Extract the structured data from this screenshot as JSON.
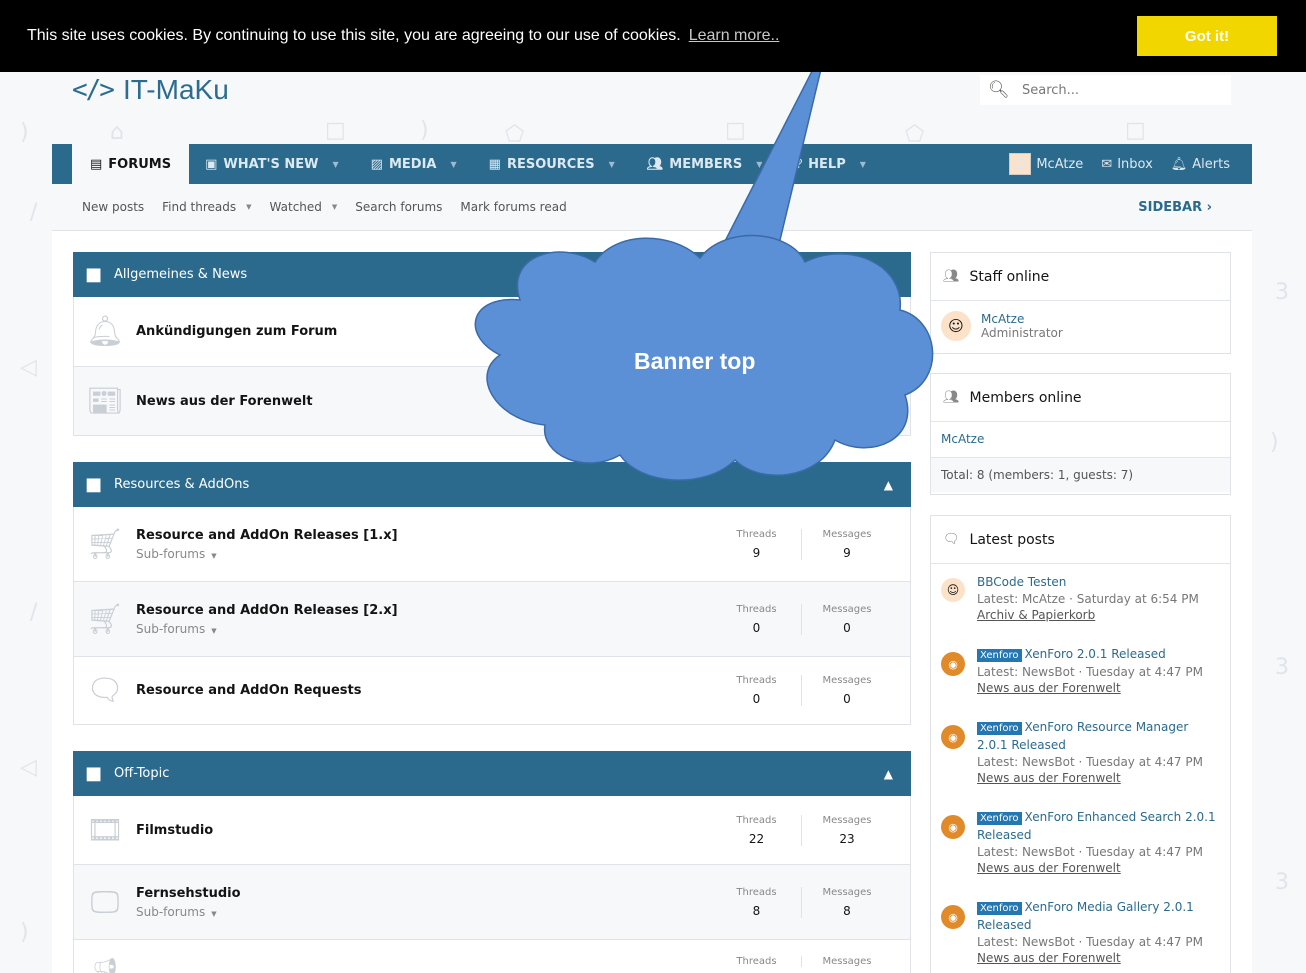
{
  "cookie": {
    "message": "This site uses cookies. By continuing to use this site, you are agreeing to our use of cookies.",
    "learn_more": "Learn more..",
    "got_it": "Got it!"
  },
  "header": {
    "logo_code": "</>",
    "logo_text": "IT-MaKu",
    "search_placeholder": "Search..."
  },
  "nav": {
    "tabs": [
      {
        "label": "Forums",
        "icon": "forum-icon"
      },
      {
        "label": "What's new",
        "icon": "whats-new-icon"
      },
      {
        "label": "Media",
        "icon": "media-icon"
      },
      {
        "label": "Resources",
        "icon": "resources-icon"
      },
      {
        "label": "Members",
        "icon": "members-icon"
      },
      {
        "label": "Help",
        "icon": "help-icon"
      }
    ],
    "user": "McAtze",
    "inbox": "Inbox",
    "alerts": "Alerts"
  },
  "subnav": {
    "new_posts": "New posts",
    "find_threads": "Find threads",
    "watched": "Watched",
    "search_forums": "Search forums",
    "mark_read": "Mark forums read",
    "sidebar": "SIDEBAR"
  },
  "categories": [
    {
      "title": "Allgemeines & News",
      "nodes": [
        {
          "title": "Ankündigungen zum Forum"
        },
        {
          "title": "News aus der Forenwelt"
        }
      ]
    },
    {
      "title": "Resources & AddOns",
      "nodes": [
        {
          "title": "Resource and AddOn Releases [1.x]",
          "sub": "Sub-forums",
          "threads": "9",
          "messages": "9"
        },
        {
          "title": "Resource and AddOn Releases [2.x]",
          "sub": "Sub-forums",
          "threads": "0",
          "messages": "0"
        },
        {
          "title": "Resource and AddOn Requests",
          "threads": "0",
          "messages": "0"
        }
      ]
    },
    {
      "title": "Off-Topic",
      "nodes": [
        {
          "title": "Filmstudio",
          "threads": "22",
          "messages": "23"
        },
        {
          "title": "Fernsehstudio",
          "sub": "Sub-forums",
          "threads": "8",
          "messages": "8"
        },
        {
          "title": "",
          "threads": "",
          "messages": ""
        }
      ]
    }
  ],
  "stat_labels": {
    "threads": "Threads",
    "messages": "Messages"
  },
  "sidebar": {
    "staff": {
      "title": "Staff online",
      "name": "McAtze",
      "role": "Administrator"
    },
    "members": {
      "title": "Members online",
      "name": "McAtze",
      "total": "Total: 8 (members: 1, guests: 7)"
    },
    "latest": {
      "title": "Latest posts",
      "posts": [
        {
          "badge": "",
          "title": "BBCode Testen",
          "meta": "Latest: McAtze · Saturday at 6:54 PM",
          "forum": "Archiv & Papierkorb"
        },
        {
          "badge": "Xenforo",
          "title": "XenForo 2.0.1 Released",
          "meta": "Latest: NewsBot · Tuesday at 4:47 PM",
          "forum": "News aus der Forenwelt"
        },
        {
          "badge": "Xenforo",
          "title": "XenForo Resource Manager 2.0.1 Released",
          "meta": "Latest: NewsBot · Tuesday at 4:47 PM",
          "forum": "News aus der Forenwelt"
        },
        {
          "badge": "Xenforo",
          "title": "XenForo Enhanced Search 2.0.1 Released",
          "meta": "Latest: NewsBot · Tuesday at 4:47 PM",
          "forum": "News aus der Forenwelt"
        },
        {
          "badge": "Xenforo",
          "title": "XenForo Media Gallery 2.0.1 Released",
          "meta": "Latest: NewsBot · Tuesday at 4:47 PM",
          "forum": "News aus der Forenwelt"
        }
      ]
    }
  },
  "callout": {
    "text": "Banner top"
  },
  "colors": {
    "nav": "#2b6a8d",
    "cookie_button": "#f1d600",
    "callout": "#5b8fd6"
  }
}
